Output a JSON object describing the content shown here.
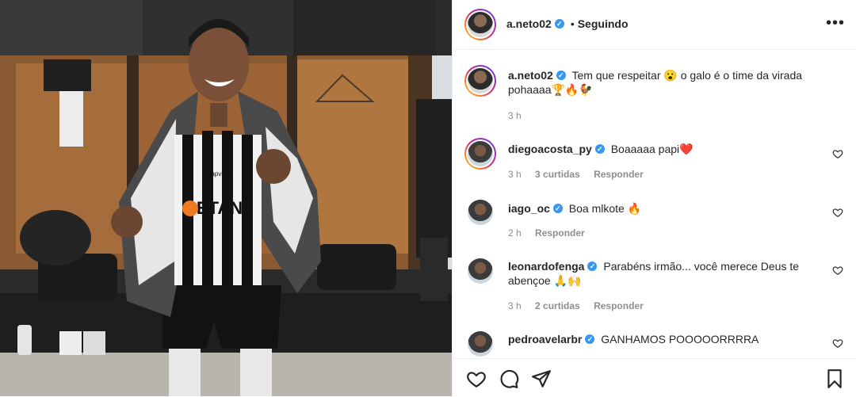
{
  "post": {
    "author": "a.neto02",
    "follow_label": "Seguindo",
    "separator": "•",
    "more_label": "•••",
    "caption": "Tem que respeitar 😮 o galo é o time da virada pohaaaa🏆🔥🐓",
    "caption_time": "3 h"
  },
  "comments": [
    {
      "user": "diegoacosta_py",
      "text": "Boaaaaa papi❤️",
      "time": "3 h",
      "likes": "3 curtidas",
      "reply": "Responder"
    },
    {
      "user": "iago_oc",
      "text": "Boa mlkote 🔥",
      "time": "2 h",
      "reply": "Responder"
    },
    {
      "user": "leonardofenga",
      "text": "Parabéns irmão... você merece Deus te abençoe 🙏🙌",
      "time": "3 h",
      "likes": "2 curtidas",
      "reply": "Responder"
    },
    {
      "user": "pedroavelarbr",
      "text": "GANHAMOS POOOOORRRRA"
    }
  ],
  "photo": {
    "jersey_sponsor": "BETAN",
    "jersey_brand": "hapvida"
  },
  "colors": {
    "verified": "#3897f0",
    "heart": "#ed4956",
    "text": "#262626",
    "muted": "#8e8e8e"
  },
  "icons": [
    "heart-icon",
    "comment-icon",
    "share-icon",
    "bookmark-icon",
    "more-icon",
    "verified-icon"
  ]
}
